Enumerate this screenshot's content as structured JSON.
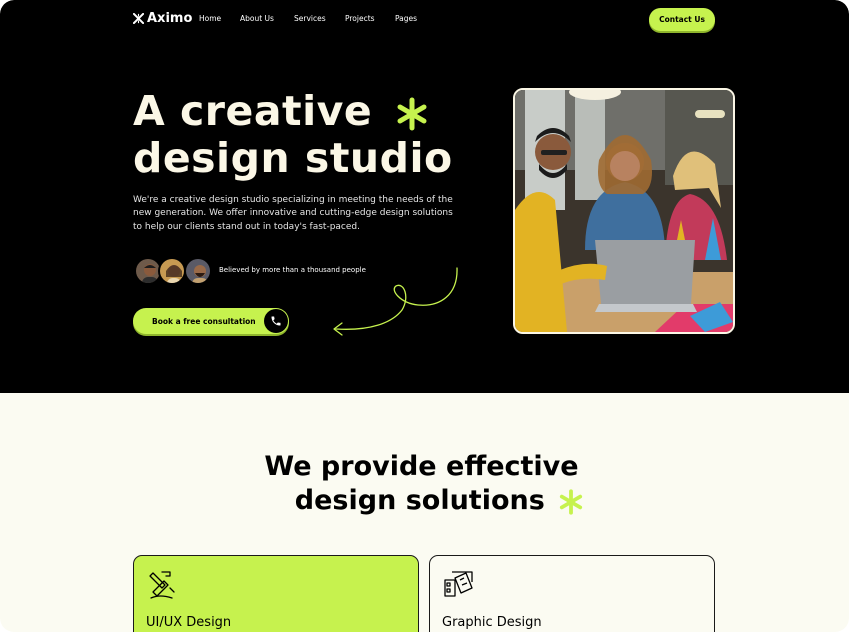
{
  "nav": {
    "brand": "Aximo",
    "links": [
      "Home",
      "About Us",
      "Services",
      "Projects",
      "Pages"
    ],
    "contact_label": "Contact Us"
  },
  "hero": {
    "title_line1": "A creative",
    "title_line2": "design studio",
    "description": "We're a creative design studio specializing in meeting the needs of the new generation. We offer innovative and cutting-edge design solutions to help our clients stand out in today's fast-paced.",
    "social_proof": "Believed by more than a thousand people",
    "cta_label": "Book a free consultation"
  },
  "services": {
    "title_line1": "We provide effective",
    "title_line2": "design solutions",
    "cards": [
      {
        "title": "UI/UX Design",
        "icon": "pen-tool-icon"
      },
      {
        "title": "Graphic Design",
        "icon": "color-swatch-icon"
      }
    ]
  },
  "colors": {
    "accent": "#c6f24e",
    "hero_bg": "#000000",
    "page_bg": "#fbfbf2",
    "cream_text": "#fbf7e6"
  }
}
